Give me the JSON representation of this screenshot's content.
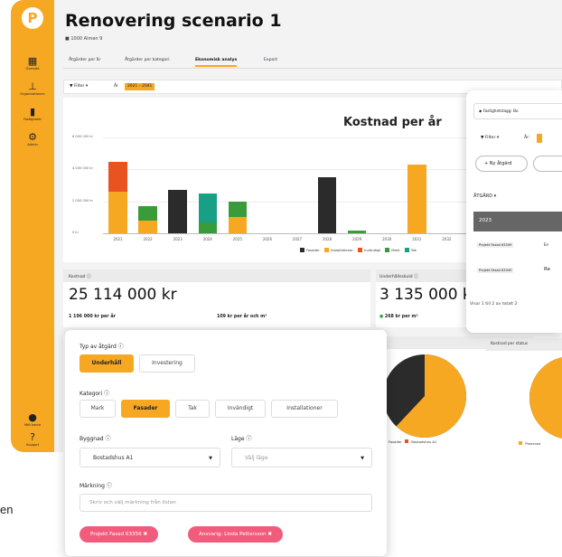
{
  "colors": {
    "accent": "#f7a823",
    "fasader": "#2b2b2b",
    "installationer": "#f7a823",
    "invandigt": "#e8531f",
    "mark": "#3a9b3a",
    "tak": "#17a085",
    "pill": "#f25c7c"
  },
  "edge_text": "en",
  "sidebar": {
    "logo": "P",
    "items": [
      {
        "label": "Översikt",
        "icon": "grid-icon"
      },
      {
        "label": "Organisationen",
        "icon": "org-chart-icon"
      },
      {
        "label": "Fastigheter",
        "icon": "building-icon"
      },
      {
        "label": "Admin",
        "icon": "gear-icon"
      }
    ],
    "bottom": [
      {
        "label": "Mitt konto",
        "icon": "user-icon"
      },
      {
        "label": "Support",
        "icon": "question-icon"
      }
    ]
  },
  "header": {
    "title": "Renovering scenario 1",
    "subtitle": "1000 Almen 9"
  },
  "tabs": [
    "Åtgärder per år",
    "Åtgärder per kategori",
    "Ekonomisk analys",
    "Export"
  ],
  "active_tab": 2,
  "filter": {
    "button": "Filter",
    "year_label": "År",
    "year_value": "2021 – 2041"
  },
  "chart_data": {
    "type": "bar",
    "stacked": true,
    "title": "Kostnad per år",
    "categories": [
      "2021",
      "2022",
      "2023",
      "2024",
      "2025",
      "2026",
      "2027",
      "2028",
      "2029",
      "2030",
      "2031",
      "2032",
      "2033"
    ],
    "y_ticks": [
      "0 kr",
      "2 000 000 kr",
      "4 000 000 kr",
      "6 000 000 kr"
    ],
    "ylim": [
      0,
      6000000
    ],
    "series": [
      {
        "name": "Fasader",
        "values": [
          0,
          0,
          2700000,
          0,
          0,
          0,
          0,
          3500000,
          0,
          0,
          0,
          0,
          0
        ]
      },
      {
        "name": "Installationer",
        "values": [
          2600000,
          800000,
          0,
          0,
          1000000,
          0,
          0,
          0,
          0,
          0,
          4300000,
          0,
          0
        ]
      },
      {
        "name": "Invändigt",
        "values": [
          1900000,
          0,
          0,
          0,
          0,
          0,
          0,
          0,
          0,
          0,
          0,
          0,
          0
        ]
      },
      {
        "name": "Mark",
        "values": [
          0,
          900000,
          0,
          700000,
          1000000,
          0,
          0,
          0,
          150000,
          0,
          0,
          0,
          0
        ]
      },
      {
        "name": "Tak",
        "values": [
          0,
          0,
          0,
          1800000,
          0,
          0,
          0,
          0,
          0,
          0,
          0,
          0,
          0
        ]
      }
    ],
    "legend": [
      "Fasader",
      "Installationer",
      "Invändigt",
      "Mark",
      "Tak"
    ],
    "legend_position": "bottom-right"
  },
  "kpi_cost": {
    "label": "Kostnad",
    "value": "25 114 000 kr",
    "per_year": "1 196 000 kr per år",
    "per_sqm": "109 kr per år och m²"
  },
  "kpi_debt": {
    "label": "Underhållsskuld",
    "value": "3 135 000 k",
    "per_sqm": "268 kr per m²"
  },
  "pie1": {
    "legend": [
      "Fasader",
      "Bostadshus A1"
    ],
    "share": 0.62
  },
  "pie2": {
    "title": "Kostnad per status",
    "legend": [
      "Planerad"
    ],
    "share": 0.72
  },
  "panel": {
    "filter_tag": "Fastighetstagg: Bo",
    "filter_button": "Filter",
    "year_label": "År:",
    "add_button": "+ Ny åtgärd",
    "column_header": "ÅTGÄRD",
    "year_row": "2023",
    "tag1": "Projekt Fasad 63349",
    "tag1_suffix": "En",
    "tag2": "Projekt Fasad 63349",
    "tag2_suffix": "Re",
    "footer": "Visar 1 till 2 av totalt 2"
  },
  "form": {
    "type_label": "Typ av åtgärd",
    "type_options": [
      "Underhåll",
      "Investering"
    ],
    "type_selected": 0,
    "category_label": "Kategori",
    "category_options": [
      "Mark",
      "Fasader",
      "Tak",
      "Invändigt",
      "Installationer"
    ],
    "category_selected": 1,
    "building_label": "Byggnad",
    "building_value": "Bostadshus A1",
    "location_label": "Läge",
    "location_placeholder": "Välj läge",
    "marking_label": "Märkning",
    "marking_placeholder": "Skriv och välj märkning från listan",
    "pills": [
      "Projekt Fasad 63356",
      "Ansvarig: Linda Pettersson"
    ]
  }
}
